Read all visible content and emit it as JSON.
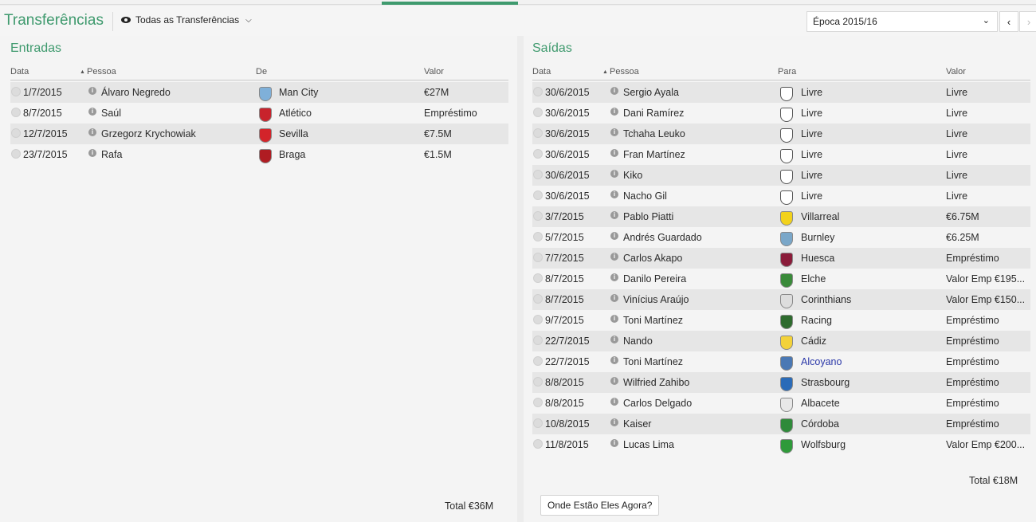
{
  "header": {
    "title": "Transferências",
    "filter_label": "Todas as Transferências",
    "season_label": "Época 2015/16"
  },
  "colors": {
    "accent": "#3f9a6e",
    "link": "#2a37a8"
  },
  "entradas": {
    "title": "Entradas",
    "columns": {
      "data": "Data",
      "pessoa": "Pessoa",
      "de": "De",
      "valor": "Valor"
    },
    "rows": [
      {
        "date": "1/7/2015",
        "person": "Álvaro Negredo",
        "club": "Man City",
        "value": "€27M",
        "crest": "#7fb0d9"
      },
      {
        "date": "8/7/2015",
        "person": "Saúl",
        "club": "Atlético",
        "value": "Empréstimo",
        "crest": "#c8232c"
      },
      {
        "date": "12/7/2015",
        "person": "Grzegorz Krychowiak",
        "club": "Sevilla",
        "value": "€7.5M",
        "crest": "#d3242a"
      },
      {
        "date": "23/7/2015",
        "person": "Rafa",
        "club": "Braga",
        "value": "€1.5M",
        "crest": "#b01c22"
      }
    ],
    "total": "Total €36M"
  },
  "saidas": {
    "title": "Saídas",
    "columns": {
      "data": "Data",
      "pessoa": "Pessoa",
      "para": "Para",
      "valor": "Valor"
    },
    "rows": [
      {
        "date": "30/6/2015",
        "person": "Sergio Ayala",
        "club": "Livre",
        "value": "Livre",
        "crest": "shield"
      },
      {
        "date": "30/6/2015",
        "person": "Dani Ramírez",
        "club": "Livre",
        "value": "Livre",
        "crest": "shield"
      },
      {
        "date": "30/6/2015",
        "person": "Tchaha Leuko",
        "club": "Livre",
        "value": "Livre",
        "crest": "shield"
      },
      {
        "date": "30/6/2015",
        "person": "Fran Martínez",
        "club": "Livre",
        "value": "Livre",
        "crest": "shield"
      },
      {
        "date": "30/6/2015",
        "person": "Kiko",
        "club": "Livre",
        "value": "Livre",
        "crest": "shield"
      },
      {
        "date": "30/6/2015",
        "person": "Nacho Gil",
        "club": "Livre",
        "value": "Livre",
        "crest": "shield"
      },
      {
        "date": "3/7/2015",
        "person": "Pablo Piatti",
        "club": "Villarreal",
        "value": "€6.75M",
        "crest": "#f2d21c"
      },
      {
        "date": "5/7/2015",
        "person": "Andrés Guardado",
        "club": "Burnley",
        "value": "€6.25M",
        "crest": "#7aa7c9"
      },
      {
        "date": "7/7/2015",
        "person": "Carlos Akapo",
        "club": "Huesca",
        "value": "Empréstimo",
        "crest": "#8a1c3a"
      },
      {
        "date": "8/7/2015",
        "person": "Danilo Pereira",
        "club": "Elche",
        "value": "Valor Emp €195...",
        "crest": "#3a8a3a"
      },
      {
        "date": "8/7/2015",
        "person": "Vinícius Araújo",
        "club": "Corinthians",
        "value": "Valor Emp €150...",
        "crest": "#dddddd"
      },
      {
        "date": "9/7/2015",
        "person": "Toni Martínez",
        "club": "Racing",
        "value": "Empréstimo",
        "crest": "#2e6b2e"
      },
      {
        "date": "22/7/2015",
        "person": "Nando",
        "club": "Cádiz",
        "value": "Empréstimo",
        "crest": "#f3d23a"
      },
      {
        "date": "22/7/2015",
        "person": "Toni Martínez",
        "club": "Alcoyano",
        "value": "Empréstimo",
        "crest": "#4a78b4",
        "link": true
      },
      {
        "date": "8/8/2015",
        "person": "Wilfried Zahibo",
        "club": "Strasbourg",
        "value": "Empréstimo",
        "crest": "#2a6bb8"
      },
      {
        "date": "8/8/2015",
        "person": "Carlos Delgado",
        "club": "Albacete",
        "value": "Empréstimo",
        "crest": "#e8e8e8"
      },
      {
        "date": "10/8/2015",
        "person": "Kaiser",
        "club": "Córdoba",
        "value": "Empréstimo",
        "crest": "#2f8a3a"
      },
      {
        "date": "11/8/2015",
        "person": "Lucas Lima",
        "club": "Wolfsburg",
        "value": "Valor Emp €200...",
        "crest": "#2f9a3a"
      }
    ],
    "total": "Total €18M",
    "where_button": "Onde Estão Eles Agora?"
  }
}
